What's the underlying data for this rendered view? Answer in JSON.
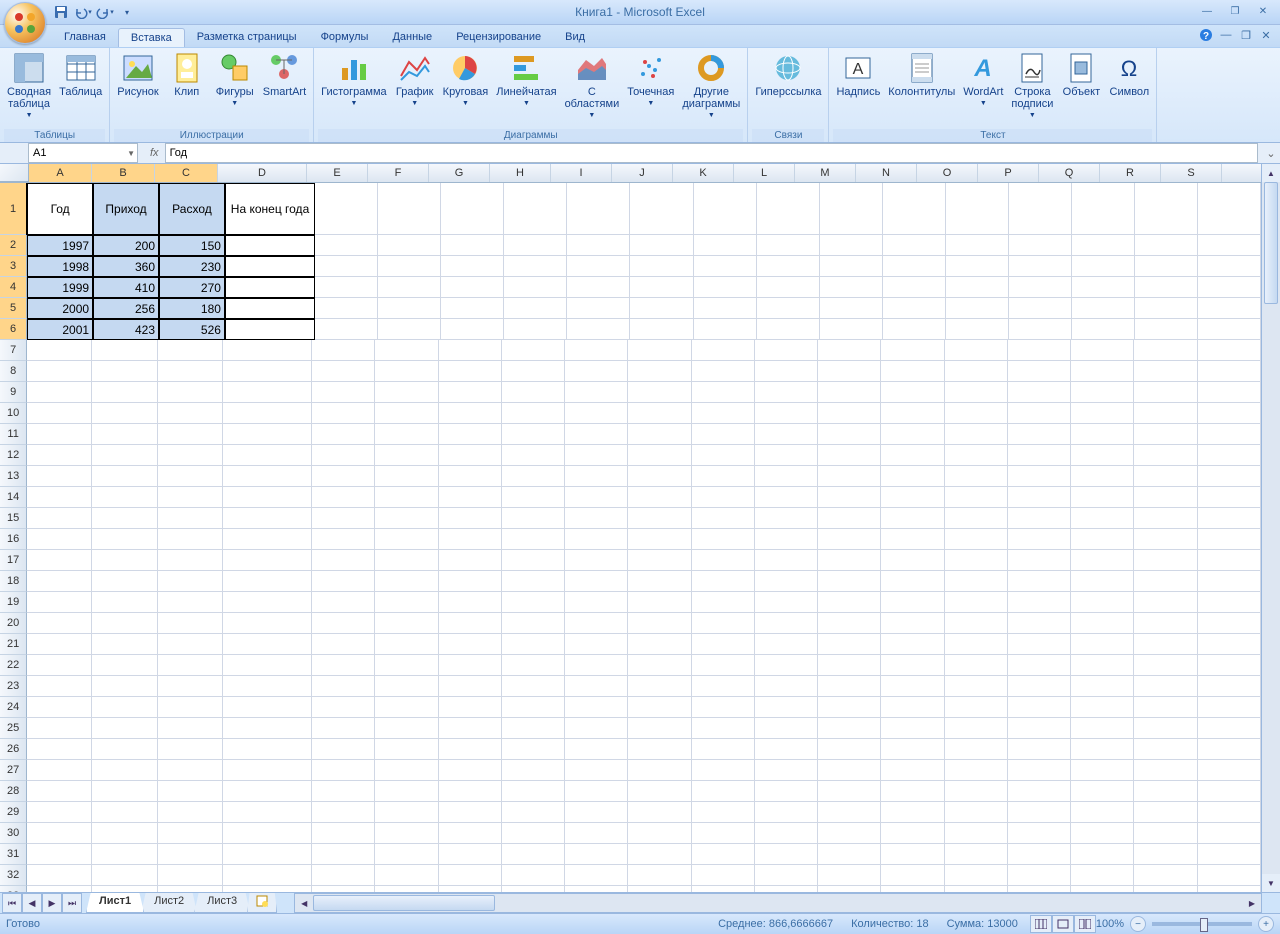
{
  "title": "Книга1 - Microsoft Excel",
  "tabs": [
    "Главная",
    "Вставка",
    "Разметка страницы",
    "Формулы",
    "Данные",
    "Рецензирование",
    "Вид"
  ],
  "active_tab_index": 1,
  "ribbon_groups": [
    {
      "label": "Таблицы",
      "items": [
        {
          "label": "Сводная\nтаблица",
          "icon": "pivot",
          "dd": true
        },
        {
          "label": "Таблица",
          "icon": "table"
        }
      ]
    },
    {
      "label": "Иллюстрации",
      "items": [
        {
          "label": "Рисунок",
          "icon": "picture"
        },
        {
          "label": "Клип",
          "icon": "clip"
        },
        {
          "label": "Фигуры",
          "icon": "shapes",
          "dd": true
        },
        {
          "label": "SmartArt",
          "icon": "smartart"
        }
      ]
    },
    {
      "label": "Диаграммы",
      "items": [
        {
          "label": "Гистограмма",
          "icon": "column",
          "dd": true
        },
        {
          "label": "График",
          "icon": "line",
          "dd": true
        },
        {
          "label": "Круговая",
          "icon": "pie",
          "dd": true
        },
        {
          "label": "Линейчатая",
          "icon": "bar",
          "dd": true
        },
        {
          "label": "С\nобластями",
          "icon": "area",
          "dd": true
        },
        {
          "label": "Точечная",
          "icon": "scatter",
          "dd": true
        },
        {
          "label": "Другие\nдиаграммы",
          "icon": "other",
          "dd": true
        }
      ]
    },
    {
      "label": "Связи",
      "items": [
        {
          "label": "Гиперссылка",
          "icon": "link"
        }
      ]
    },
    {
      "label": "Текст",
      "items": [
        {
          "label": "Надпись",
          "icon": "textbox"
        },
        {
          "label": "Колонтитулы",
          "icon": "headerfooter"
        },
        {
          "label": "WordArt",
          "icon": "wordart",
          "dd": true
        },
        {
          "label": "Строка\nподписи",
          "icon": "sigline",
          "dd": true
        },
        {
          "label": "Объект",
          "icon": "object"
        },
        {
          "label": "Символ",
          "icon": "symbol"
        }
      ]
    }
  ],
  "namebox": "A1",
  "formula": "Год",
  "columns": [
    "A",
    "B",
    "C",
    "D",
    "E",
    "F",
    "G",
    "H",
    "I",
    "J",
    "K",
    "L",
    "M",
    "N",
    "O",
    "P",
    "Q",
    "R",
    "S"
  ],
  "col_widths": {
    "default": 60,
    "A": 62,
    "B": 62,
    "C": 62,
    "D": 88
  },
  "selected_cols": [
    "A",
    "B",
    "C"
  ],
  "row_count": 33,
  "header_row_height": 52,
  "table": {
    "header": [
      "Год",
      "Приход",
      "Расход",
      "На конец года"
    ],
    "rows": [
      [
        1997,
        200,
        150,
        ""
      ],
      [
        1998,
        360,
        230,
        ""
      ],
      [
        1999,
        410,
        270,
        ""
      ],
      [
        2000,
        256,
        180,
        ""
      ],
      [
        2001,
        423,
        526,
        ""
      ]
    ]
  },
  "selection": {
    "range": "A1:C6",
    "active": "A1"
  },
  "sheets": [
    "Лист1",
    "Лист2",
    "Лист3"
  ],
  "active_sheet": 0,
  "status": {
    "ready": "Готово",
    "avg_label": "Среднее:",
    "avg": "866,6666667",
    "count_label": "Количество:",
    "count": "18",
    "sum_label": "Сумма:",
    "sum": "13000",
    "zoom": "100%"
  }
}
